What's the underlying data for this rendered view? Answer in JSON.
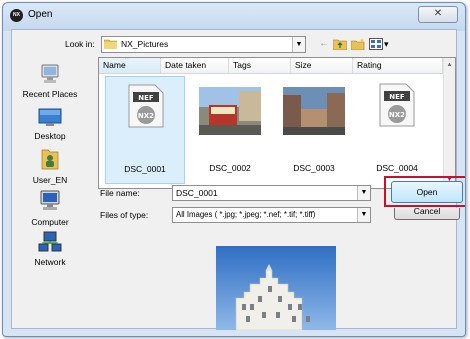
{
  "window": {
    "title": "Open",
    "app_icon_text": "NX",
    "close_symbol": "✕"
  },
  "toolbar": {
    "look_in_label": "Look in:",
    "look_in_value": "NX_Pictures",
    "dropdown_arrow": "▼",
    "back_icon": "←",
    "view_menu_arrow": "▾"
  },
  "places": [
    {
      "label": "Recent Places",
      "icon": "recent-places-icon"
    },
    {
      "label": "Desktop",
      "icon": "desktop-icon"
    },
    {
      "label": "User_EN",
      "icon": "user-folder-icon"
    },
    {
      "label": "Computer",
      "icon": "computer-icon"
    },
    {
      "label": "Network",
      "icon": "network-icon"
    }
  ],
  "file_list": {
    "columns": [
      "Name",
      "Date taken",
      "Tags",
      "Size",
      "Rating"
    ],
    "sort_indicator": "^",
    "scroll_up": "▲",
    "scroll_down": "▼",
    "items": [
      {
        "name": "DSC_0001",
        "type": "nef-raw",
        "badge_top": "NEF",
        "badge_bottom": "NX2",
        "selected": true
      },
      {
        "name": "DSC_0002",
        "type": "photo-streetcar",
        "selected": false
      },
      {
        "name": "DSC_0003",
        "type": "photo-street",
        "selected": false
      },
      {
        "name": "DSC_0004",
        "type": "nef-raw",
        "badge_top": "NEF",
        "badge_bottom": "NX2",
        "selected": false
      }
    ]
  },
  "form": {
    "file_name_label": "File name:",
    "file_name_value": "DSC_0001",
    "file_type_label": "Files of type:",
    "file_type_value": "All Images ( *.jpg; *.jpeg; *.nef; *.tif; *.tiff)"
  },
  "buttons": {
    "open_label": "Open",
    "cancel_label": "Cancel"
  },
  "colors": {
    "highlight": "#c8102e",
    "selection": "#dbeefc"
  }
}
